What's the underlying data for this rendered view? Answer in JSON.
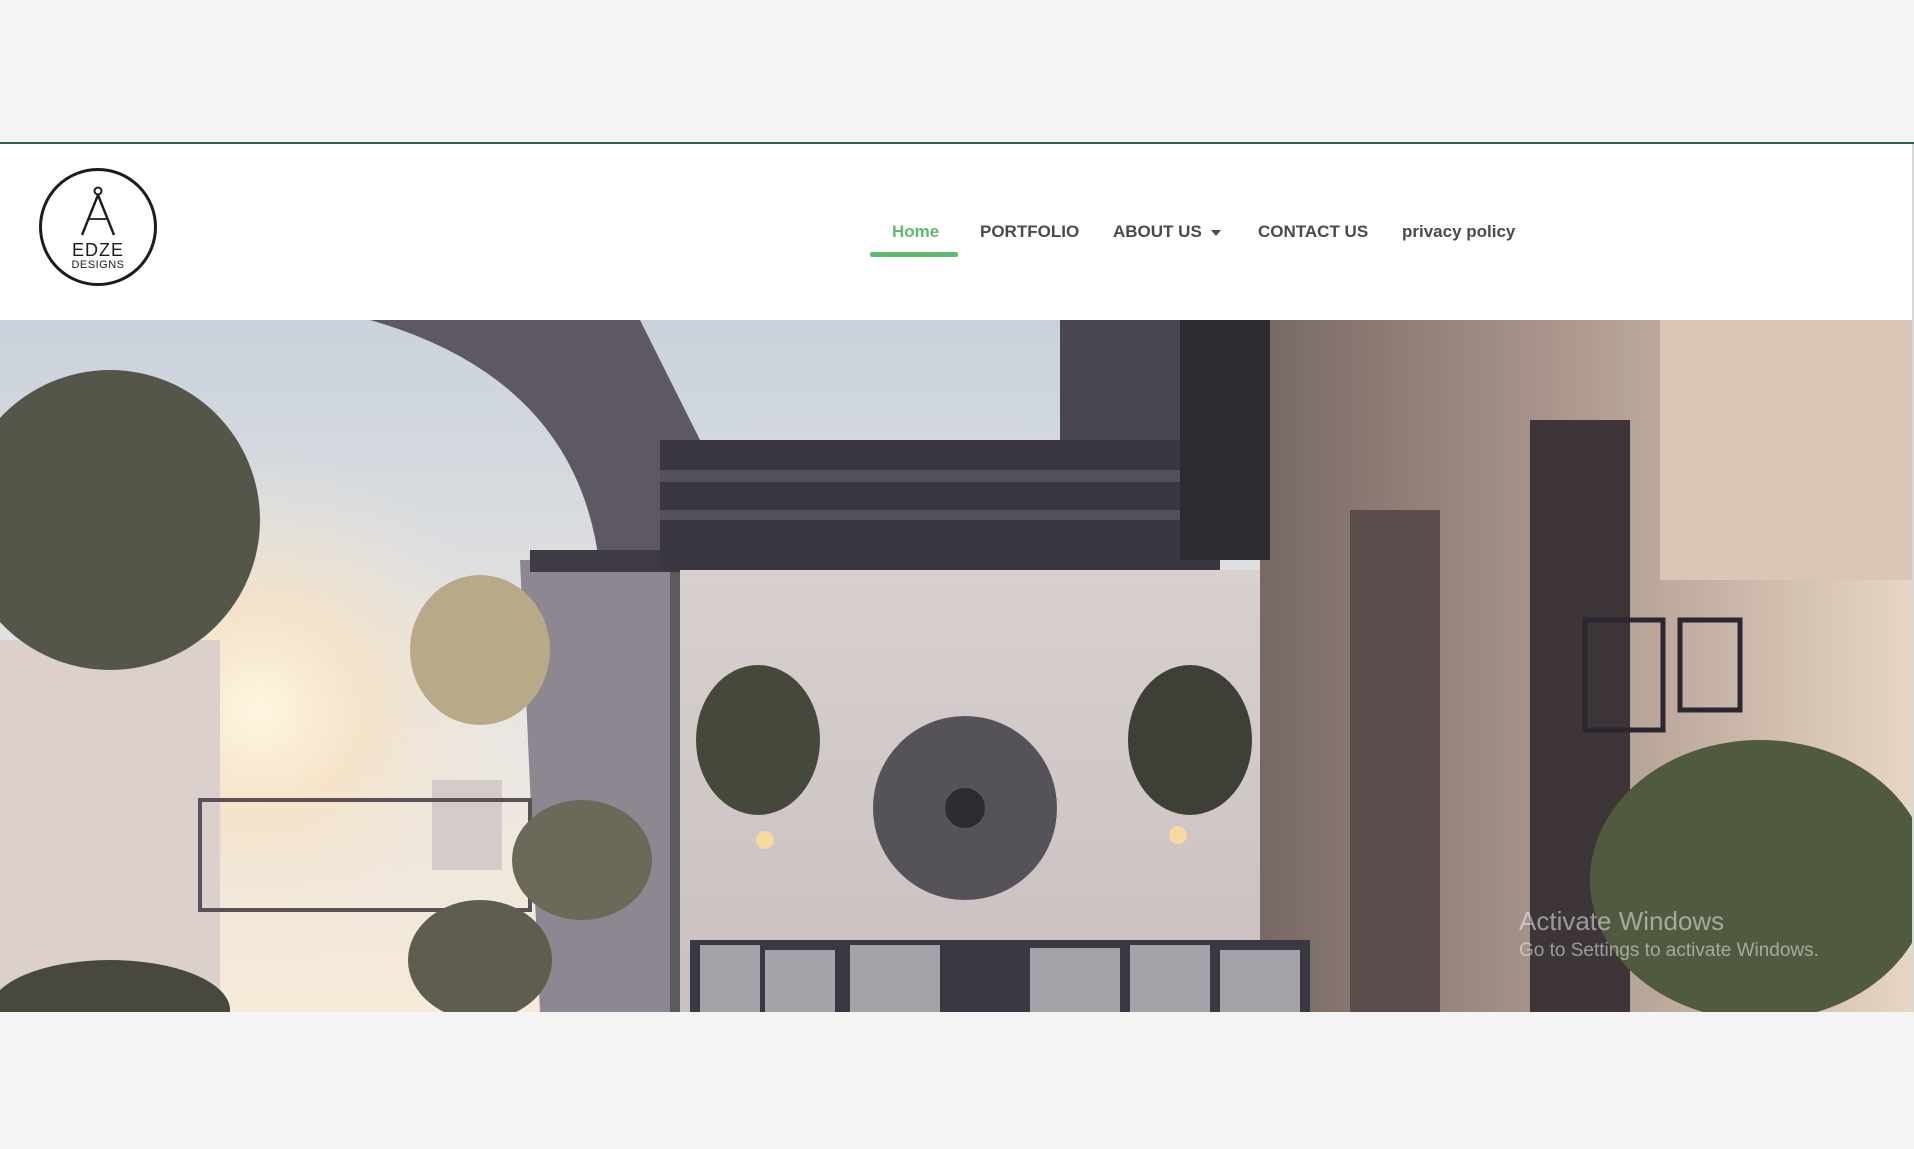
{
  "logo": {
    "line1": "EDZE",
    "line2": "DESIGNS",
    "icon": "compass-icon"
  },
  "nav": {
    "items": [
      {
        "label": "Home",
        "active": true
      },
      {
        "label": "PORTFOLIO",
        "active": false
      },
      {
        "label": "ABOUT US",
        "active": false,
        "dropdown": true
      },
      {
        "label": "CONTACT US",
        "active": false
      },
      {
        "label": "privacy policy",
        "active": false
      }
    ]
  },
  "hero": {
    "image": "rooftop-terrace-photo"
  },
  "watermark": {
    "line1": "Activate Windows",
    "line2": "Go to Settings to activate Windows."
  },
  "colors": {
    "accent": "#5dbb70",
    "nav_text": "#4a4a4a",
    "top_rule": "#2f5d58",
    "page_bg": "#f4f4f4"
  }
}
